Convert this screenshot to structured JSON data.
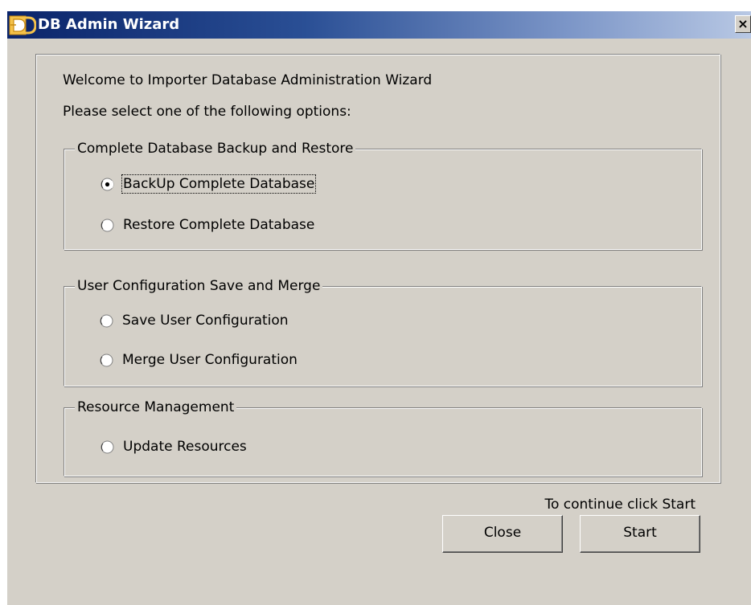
{
  "window": {
    "title": "DB Admin Wizard",
    "close_glyph": "×",
    "title_colors": {
      "start": "#0a246a",
      "end": "#b8c8e4"
    }
  },
  "intro": {
    "welcome": "Welcome to Importer Database Administration Wizard",
    "instruction": "Please select one of the following options:"
  },
  "groups": [
    {
      "legend": "Complete Database Backup and Restore",
      "options": [
        {
          "label": "BackUp Complete Database",
          "checked": true,
          "focused": true
        },
        {
          "label": "Restore Complete Database",
          "checked": false
        }
      ]
    },
    {
      "legend": "User Configuration Save and Merge",
      "options": [
        {
          "label": "Save User Configuration",
          "checked": false
        },
        {
          "label": "Merge User Configuration",
          "checked": false
        }
      ]
    },
    {
      "legend": "Resource Management",
      "options": [
        {
          "label": "Update Resources",
          "checked": false
        }
      ]
    }
  ],
  "footer": {
    "hint": "To continue click Start",
    "close_label": "Close",
    "start_label": "Start"
  },
  "icons": {
    "app": "db-wizard-icon",
    "close": "close-icon",
    "radio_checked": "radio-checked-icon",
    "radio_unchecked": "radio-unchecked-icon"
  }
}
